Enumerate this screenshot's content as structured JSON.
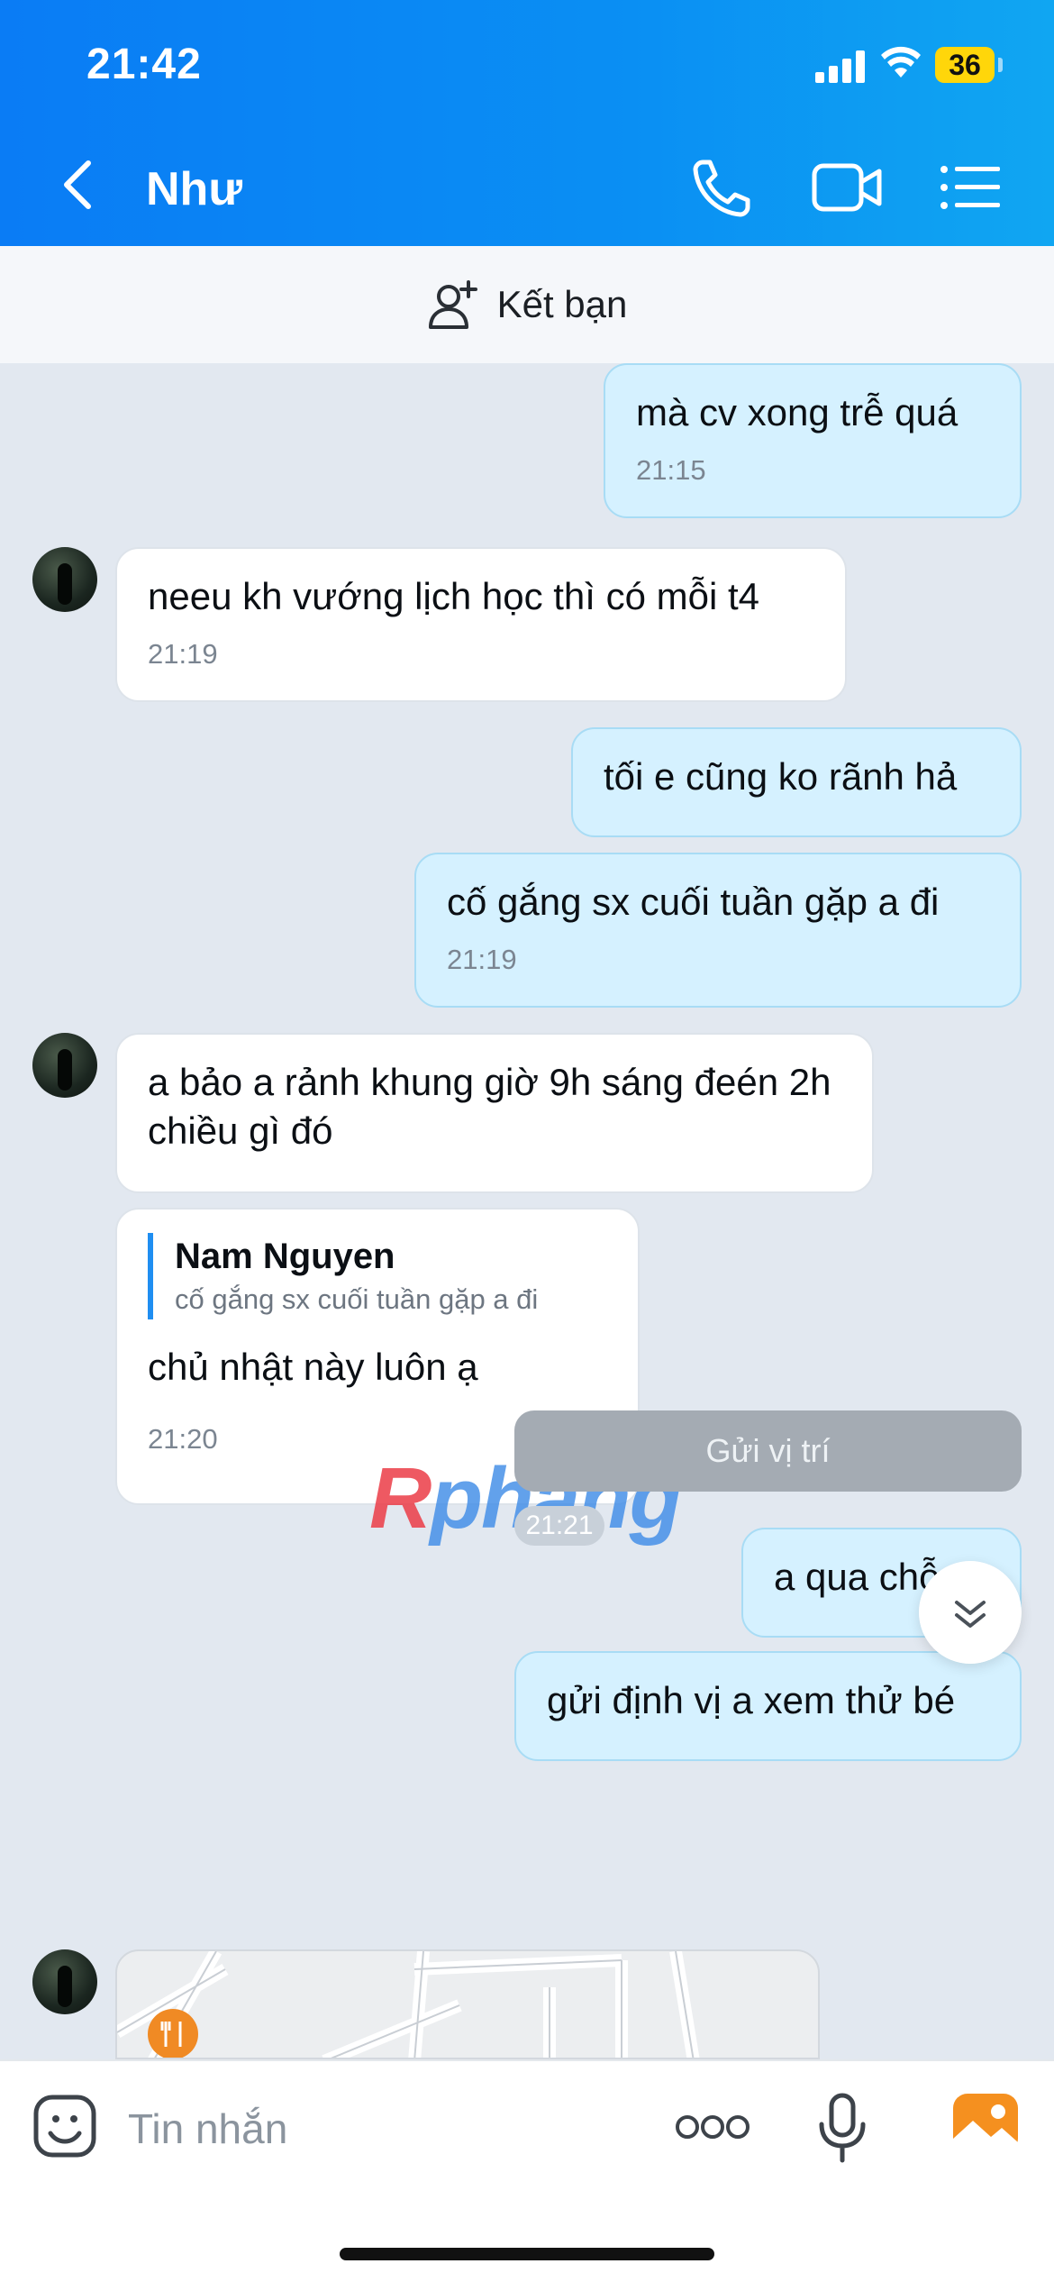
{
  "status_bar": {
    "time": "21:42",
    "battery": "36"
  },
  "header": {
    "title": "Như",
    "back_icon": "chevron-left-icon",
    "call_icon": "phone-icon",
    "video_icon": "video-camera-icon",
    "menu_icon": "list-menu-icon"
  },
  "friend_bar": {
    "label": "Kết bạn",
    "icon": "add-person-icon"
  },
  "messages": [
    {
      "direction": "out",
      "text": "mà cv xong trễ quá",
      "time": "21:15"
    },
    {
      "direction": "in",
      "text": "neeu kh vướng lịch học thì có mỗi t4",
      "time": "21:19"
    },
    {
      "direction": "out",
      "text": "tối e cũng ko rãnh hả",
      "time": ""
    },
    {
      "direction": "out",
      "text": "cố gắng sx cuối tuần gặp a đi",
      "time": "21:19"
    },
    {
      "direction": "in",
      "text": "a bảo a rảnh khung giờ 9h sáng đeén 2h chiều gì đó",
      "time": ""
    },
    {
      "direction": "in",
      "quote_name": "Nam Nguyen",
      "quote_text": "cố gắng sx cuối tuần gặp a đi",
      "text": "chủ nhật này luôn ạ",
      "time": "21:20"
    },
    {
      "direction": "out",
      "text": "a qua chỗ e",
      "time": ""
    },
    {
      "direction": "out",
      "text": "gửi định vị a xem thử bé",
      "time": ""
    }
  ],
  "location_button": "Gửi vị trí",
  "location_time": "21:21",
  "watermark": {
    "r": "R",
    "rest": "phang"
  },
  "input": {
    "placeholder": "Tin nhắn",
    "emoji_icon": "sticker-icon",
    "more_icon": "more-dots-icon",
    "mic_icon": "microphone-icon",
    "image_icon": "image-icon"
  },
  "colors": {
    "header": "#0a8ff3",
    "bubble_out": "#d5f1ff",
    "bubble_in": "#ffffff",
    "background": "#e2e8f0"
  }
}
